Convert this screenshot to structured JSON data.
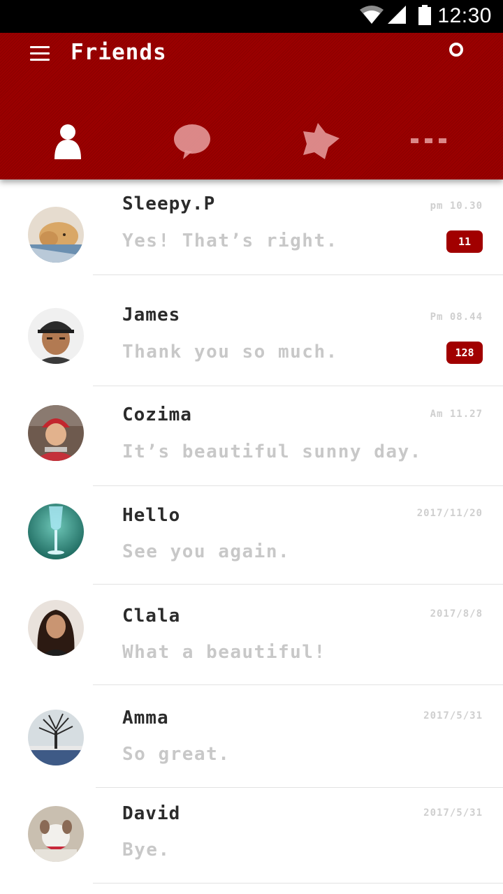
{
  "status_bar": {
    "time": "12:30",
    "icons": [
      "wifi-icon",
      "signal-icon",
      "battery-icon"
    ]
  },
  "header": {
    "title": "Friends",
    "background_color": "#9b0000",
    "menu_icon": "hamburger-icon",
    "search_icon": "search-icon"
  },
  "tabs": [
    {
      "name": "friends",
      "icon": "person-icon",
      "active": true
    },
    {
      "name": "chats",
      "icon": "chat-bubble-icon",
      "active": false
    },
    {
      "name": "favorites",
      "icon": "star-icon",
      "active": false
    },
    {
      "name": "more",
      "icon": "more-dots-icon",
      "active": false
    }
  ],
  "conversations": [
    {
      "name": "Sleepy.P",
      "message": "Yes! That’s right.",
      "time": "pm 10.30",
      "unread": "11",
      "avatar": "puppy-avatar"
    },
    {
      "name": "James",
      "message": "Thank you so much.",
      "time": "Pm 08.44",
      "unread": "128",
      "avatar": "man-cap-avatar"
    },
    {
      "name": "Cozima",
      "message": "It’s beautiful sunny day.",
      "time": "Am 11.27",
      "unread": "",
      "avatar": "woman-beanie-avatar"
    },
    {
      "name": "Hello",
      "message": "See you again.",
      "time": "2017/11/20",
      "unread": "",
      "avatar": "glass-avatar"
    },
    {
      "name": "Clala",
      "message": "What a beautiful!",
      "time": "2017/8/8",
      "unread": "",
      "avatar": "woman-avatar"
    },
    {
      "name": "Amma",
      "message": "So great.",
      "time": "2017/5/31",
      "unread": "",
      "avatar": "tree-avatar"
    },
    {
      "name": "David",
      "message": "Bye.",
      "time": "2017/5/31",
      "unread": "",
      "avatar": "dog-avatar"
    }
  ],
  "colors": {
    "accent": "#a10000",
    "name_text": "#2b2b2b",
    "preview_text": "#c8c8c8",
    "timestamp_text": "#cfcfcf"
  }
}
